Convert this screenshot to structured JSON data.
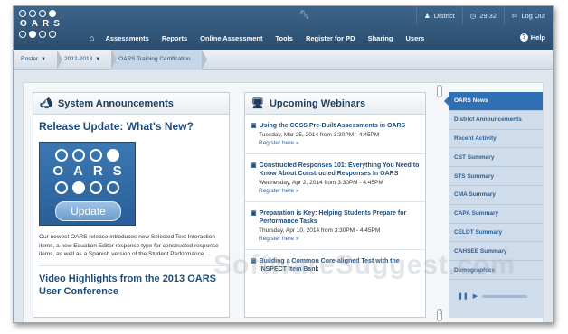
{
  "app": {
    "logo_text": [
      "O",
      "A",
      "R",
      "S"
    ],
    "brand_color": "#2b4d70",
    "accent_color": "#2f6fb4"
  },
  "top_utilities": {
    "wrench_icon": "wrench-icon",
    "district_label": "District",
    "time": "29:32",
    "logout_label": "Log Out"
  },
  "nav": {
    "home_icon": "home-icon",
    "items": [
      "Assessments",
      "Reports",
      "Online Assessment",
      "Tools",
      "Register for PD",
      "Sharing",
      "Users"
    ],
    "help_label": "Help"
  },
  "breadcrumb": [
    {
      "label": "Roster"
    },
    {
      "label": "2012-2013"
    },
    {
      "label": "OARS Training Certification"
    }
  ],
  "announcements": {
    "title": "System Announcements",
    "release_title": "Release Update: What's New?",
    "image_logo": [
      "O",
      "A",
      "R",
      "S"
    ],
    "update_button": "Update",
    "body": "Our newest OARS release introduces new Selected Text Interaction items, a new Equation Editor response type for constructed response items, as well as a Spanish version of the Student Performance ...",
    "video_title": "Video Highlights from the 2013 OARS User Conference"
  },
  "webinars": {
    "title": "Upcoming Webinars",
    "items": [
      {
        "title": "Using the CCSS Pre-Built Assessments in OARS",
        "date": "Tuesday, Mar 25, 2014 from 3:30PM - 4:45PM",
        "link": "Register here »"
      },
      {
        "title": "Constructed Responses 101: Everything You Need to Know About Constructed Responses In OARS",
        "date": "Wednesday, Apr 2, 2014 from 3:30PM - 4:45PM",
        "link": "Register here »"
      },
      {
        "title": "Preparation is Key: Helping Students Prepare for Performance Tasks",
        "date": "Thursday, Apr 10, 2014 from 3:30PM - 4:45PM",
        "link": "Register here »"
      },
      {
        "title": "Building a Common Core-aligned Test with the INSPECT Item Bank",
        "date": "",
        "link": ""
      }
    ]
  },
  "sidebar": {
    "items": [
      {
        "label": "OARS News"
      },
      {
        "label": "District Announcements"
      },
      {
        "label": "Recent Activity"
      },
      {
        "label": "CST Summary"
      },
      {
        "label": "STS Summary"
      },
      {
        "label": "CMA Summary"
      },
      {
        "label": "CAPA Summary"
      },
      {
        "label": "CELDT Summary"
      },
      {
        "label": "CAHSEE Summary"
      },
      {
        "label": "Demographics"
      }
    ],
    "active_index": 0
  },
  "watermark": "SoftwareSuggest.com"
}
